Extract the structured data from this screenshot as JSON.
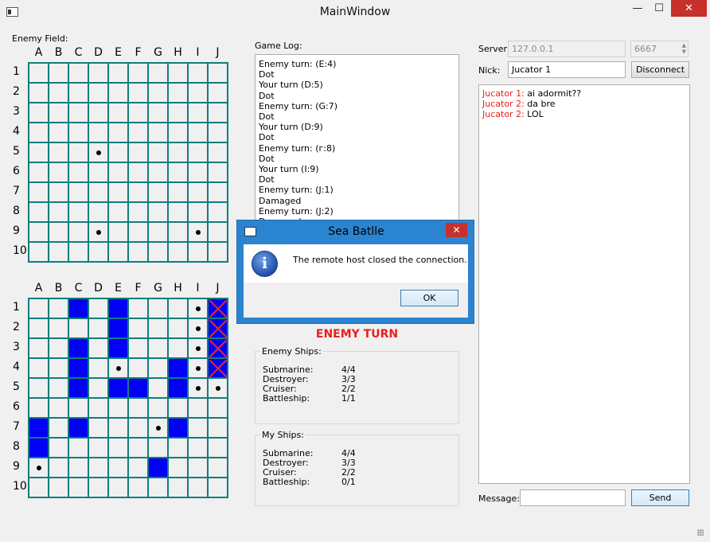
{
  "window": {
    "title": "MainWindow",
    "minimize": "—",
    "maximize": "☐",
    "close": "✕"
  },
  "enemy_field": {
    "label": "Enemy Field:",
    "columns": [
      "A",
      "B",
      "C",
      "D",
      "E",
      "F",
      "G",
      "H",
      "I",
      "J"
    ],
    "rows": [
      "1",
      "2",
      "3",
      "4",
      "5",
      "6",
      "7",
      "8",
      "9",
      "10"
    ],
    "dots": [
      [
        4,
        3
      ],
      [
        8,
        3
      ],
      [
        8,
        8
      ]
    ],
    "ships": [],
    "hits": []
  },
  "my_field": {
    "columns": [
      "A",
      "B",
      "C",
      "D",
      "E",
      "F",
      "G",
      "H",
      "I",
      "J"
    ],
    "rows": [
      "1",
      "2",
      "3",
      "4",
      "5",
      "6",
      "7",
      "8",
      "9",
      "10"
    ],
    "ships": [
      [
        0,
        2
      ],
      [
        0,
        4
      ],
      [
        1,
        4
      ],
      [
        2,
        2
      ],
      [
        2,
        4
      ],
      [
        3,
        2
      ],
      [
        3,
        7
      ],
      [
        4,
        2
      ],
      [
        4,
        4
      ],
      [
        4,
        5
      ],
      [
        4,
        7
      ],
      [
        6,
        0
      ],
      [
        6,
        2
      ],
      [
        6,
        7
      ],
      [
        7,
        0
      ],
      [
        8,
        6
      ]
    ],
    "hits": [
      [
        0,
        9
      ],
      [
        1,
        9
      ],
      [
        2,
        9
      ],
      [
        3,
        9
      ]
    ],
    "dots": [
      [
        0,
        8
      ],
      [
        1,
        8
      ],
      [
        2,
        8
      ],
      [
        3,
        4
      ],
      [
        3,
        8
      ],
      [
        4,
        8
      ],
      [
        4,
        9
      ],
      [
        6,
        6
      ],
      [
        8,
        0
      ]
    ]
  },
  "game_log": {
    "label": "Game Log:",
    "lines": [
      "Enemy turn: (E:4)",
      "Dot",
      "Your turn (D:5)",
      "Dot",
      "Enemy turn: (G:7)",
      "Dot",
      "Your turn (D:9)",
      "Dot",
      "Enemy turn: (г:8)",
      "Dot",
      "Your turn (I:9)",
      "Dot",
      "Enemy turn: (J:1)",
      "Damaged",
      "Enemy turn: (J:2)",
      "Damaged"
    ]
  },
  "turn_status": "ENEMY TURN",
  "enemy_ships": {
    "title": "Enemy Ships:",
    "rows": [
      {
        "name": "Submarine:",
        "count": "4/4"
      },
      {
        "name": "Destroyer:",
        "count": "3/3"
      },
      {
        "name": "Cruiser:",
        "count": "2/2"
      },
      {
        "name": "Battleship:",
        "count": "1/1"
      }
    ]
  },
  "my_ships": {
    "title": "My Ships:",
    "rows": [
      {
        "name": "Submarine:",
        "count": "4/4"
      },
      {
        "name": "Destroyer:",
        "count": "3/3"
      },
      {
        "name": "Cruiser:",
        "count": "2/2"
      },
      {
        "name": "Battleship:",
        "count": "0/1"
      }
    ]
  },
  "connection": {
    "server_label": "Server",
    "server_value": "127.0.0.1",
    "port_value": "6667",
    "nick_label": "Nick:",
    "nick_value": "Jucator 1",
    "disconnect_label": "Disconnect"
  },
  "chat": {
    "messages": [
      {
        "nick": "Jucator 1:",
        "text": " ai adormit??"
      },
      {
        "nick": "Jucator 2:",
        "text": " da bre"
      },
      {
        "nick": "Jucator 2:",
        "text": " LOL"
      }
    ],
    "message_label": "Message:",
    "message_value": "",
    "send_label": "Send"
  },
  "dialog": {
    "title": "Sea Batlle",
    "message": "The remote host closed the connection.",
    "ok_label": "OK",
    "close": "✕"
  },
  "colors": {
    "grid_line": "#117d7d",
    "ship": "#0000f4",
    "hit_cross": "#e8272b",
    "turn_status": "#e81f1d",
    "chat_nick": "#e8211d"
  }
}
